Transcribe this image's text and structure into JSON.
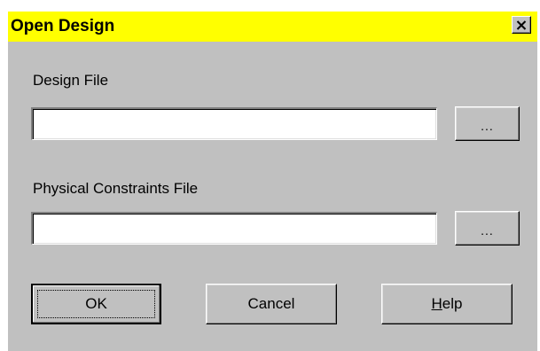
{
  "window": {
    "title": "Open Design",
    "title_bar_color": "#ffff00",
    "close_icon": "close-icon",
    "close_glyph": "×"
  },
  "design_file": {
    "label": "Design File",
    "value": "",
    "browse_label": "..."
  },
  "constraints_file": {
    "label": "Physical Constraints File",
    "value": "",
    "browse_label": "..."
  },
  "buttons": {
    "ok_label": "OK",
    "cancel_label": "Cancel",
    "help_mnemonic": "H",
    "help_rest": "elp"
  }
}
